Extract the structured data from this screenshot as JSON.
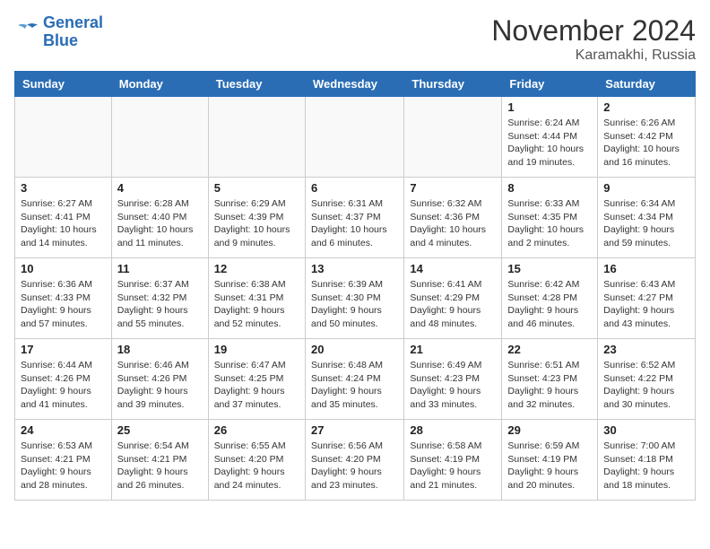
{
  "logo": {
    "general": "General",
    "blue": "Blue"
  },
  "header": {
    "month": "November 2024",
    "location": "Karamakhi, Russia"
  },
  "weekdays": [
    "Sunday",
    "Monday",
    "Tuesday",
    "Wednesday",
    "Thursday",
    "Friday",
    "Saturday"
  ],
  "weeks": [
    [
      {
        "day": "",
        "info": ""
      },
      {
        "day": "",
        "info": ""
      },
      {
        "day": "",
        "info": ""
      },
      {
        "day": "",
        "info": ""
      },
      {
        "day": "",
        "info": ""
      },
      {
        "day": "1",
        "info": "Sunrise: 6:24 AM\nSunset: 4:44 PM\nDaylight: 10 hours and 19 minutes."
      },
      {
        "day": "2",
        "info": "Sunrise: 6:26 AM\nSunset: 4:42 PM\nDaylight: 10 hours and 16 minutes."
      }
    ],
    [
      {
        "day": "3",
        "info": "Sunrise: 6:27 AM\nSunset: 4:41 PM\nDaylight: 10 hours and 14 minutes."
      },
      {
        "day": "4",
        "info": "Sunrise: 6:28 AM\nSunset: 4:40 PM\nDaylight: 10 hours and 11 minutes."
      },
      {
        "day": "5",
        "info": "Sunrise: 6:29 AM\nSunset: 4:39 PM\nDaylight: 10 hours and 9 minutes."
      },
      {
        "day": "6",
        "info": "Sunrise: 6:31 AM\nSunset: 4:37 PM\nDaylight: 10 hours and 6 minutes."
      },
      {
        "day": "7",
        "info": "Sunrise: 6:32 AM\nSunset: 4:36 PM\nDaylight: 10 hours and 4 minutes."
      },
      {
        "day": "8",
        "info": "Sunrise: 6:33 AM\nSunset: 4:35 PM\nDaylight: 10 hours and 2 minutes."
      },
      {
        "day": "9",
        "info": "Sunrise: 6:34 AM\nSunset: 4:34 PM\nDaylight: 9 hours and 59 minutes."
      }
    ],
    [
      {
        "day": "10",
        "info": "Sunrise: 6:36 AM\nSunset: 4:33 PM\nDaylight: 9 hours and 57 minutes."
      },
      {
        "day": "11",
        "info": "Sunrise: 6:37 AM\nSunset: 4:32 PM\nDaylight: 9 hours and 55 minutes."
      },
      {
        "day": "12",
        "info": "Sunrise: 6:38 AM\nSunset: 4:31 PM\nDaylight: 9 hours and 52 minutes."
      },
      {
        "day": "13",
        "info": "Sunrise: 6:39 AM\nSunset: 4:30 PM\nDaylight: 9 hours and 50 minutes."
      },
      {
        "day": "14",
        "info": "Sunrise: 6:41 AM\nSunset: 4:29 PM\nDaylight: 9 hours and 48 minutes."
      },
      {
        "day": "15",
        "info": "Sunrise: 6:42 AM\nSunset: 4:28 PM\nDaylight: 9 hours and 46 minutes."
      },
      {
        "day": "16",
        "info": "Sunrise: 6:43 AM\nSunset: 4:27 PM\nDaylight: 9 hours and 43 minutes."
      }
    ],
    [
      {
        "day": "17",
        "info": "Sunrise: 6:44 AM\nSunset: 4:26 PM\nDaylight: 9 hours and 41 minutes."
      },
      {
        "day": "18",
        "info": "Sunrise: 6:46 AM\nSunset: 4:26 PM\nDaylight: 9 hours and 39 minutes."
      },
      {
        "day": "19",
        "info": "Sunrise: 6:47 AM\nSunset: 4:25 PM\nDaylight: 9 hours and 37 minutes."
      },
      {
        "day": "20",
        "info": "Sunrise: 6:48 AM\nSunset: 4:24 PM\nDaylight: 9 hours and 35 minutes."
      },
      {
        "day": "21",
        "info": "Sunrise: 6:49 AM\nSunset: 4:23 PM\nDaylight: 9 hours and 33 minutes."
      },
      {
        "day": "22",
        "info": "Sunrise: 6:51 AM\nSunset: 4:23 PM\nDaylight: 9 hours and 32 minutes."
      },
      {
        "day": "23",
        "info": "Sunrise: 6:52 AM\nSunset: 4:22 PM\nDaylight: 9 hours and 30 minutes."
      }
    ],
    [
      {
        "day": "24",
        "info": "Sunrise: 6:53 AM\nSunset: 4:21 PM\nDaylight: 9 hours and 28 minutes."
      },
      {
        "day": "25",
        "info": "Sunrise: 6:54 AM\nSunset: 4:21 PM\nDaylight: 9 hours and 26 minutes."
      },
      {
        "day": "26",
        "info": "Sunrise: 6:55 AM\nSunset: 4:20 PM\nDaylight: 9 hours and 24 minutes."
      },
      {
        "day": "27",
        "info": "Sunrise: 6:56 AM\nSunset: 4:20 PM\nDaylight: 9 hours and 23 minutes."
      },
      {
        "day": "28",
        "info": "Sunrise: 6:58 AM\nSunset: 4:19 PM\nDaylight: 9 hours and 21 minutes."
      },
      {
        "day": "29",
        "info": "Sunrise: 6:59 AM\nSunset: 4:19 PM\nDaylight: 9 hours and 20 minutes."
      },
      {
        "day": "30",
        "info": "Sunrise: 7:00 AM\nSunset: 4:18 PM\nDaylight: 9 hours and 18 minutes."
      }
    ]
  ]
}
